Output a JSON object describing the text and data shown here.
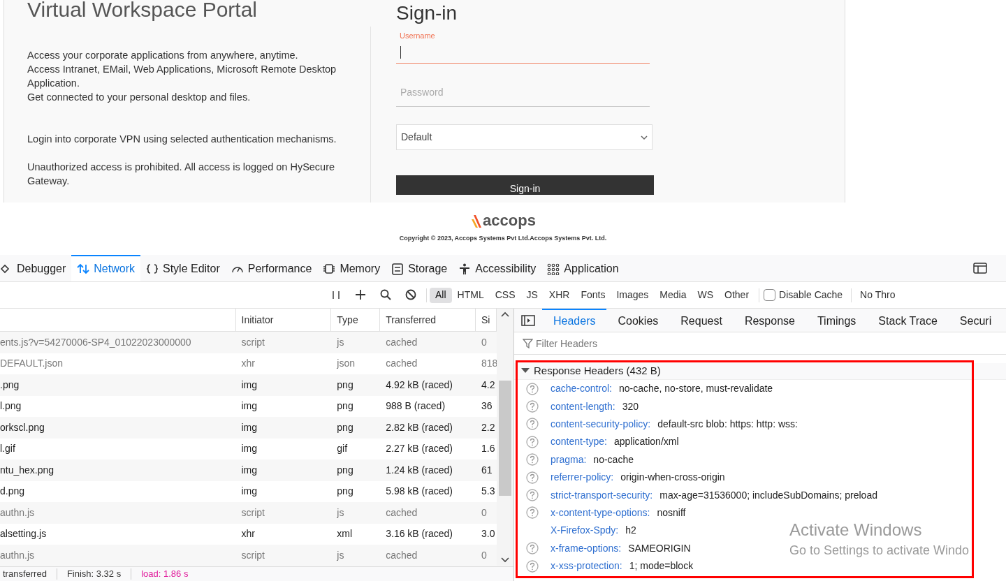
{
  "portal": {
    "title": "Virtual Workspace Portal",
    "paragraphs": [
      "Access your corporate applications from anywhere, anytime.\nAccess Intranet, EMail, Web Applications, Microsoft Remote Desktop Application.\nGet connected to your personal desktop and files.",
      "Login into corporate VPN using selected authentication mechanisms.",
      "Unauthorized access is prohibited. All access is logged on HySecure Gateway."
    ]
  },
  "signin": {
    "title": "Sign-in",
    "username": {
      "label": "Username",
      "focused": true
    },
    "password": {
      "placeholder": "Password"
    },
    "realm": {
      "value": "Default"
    },
    "button": "Sign-in"
  },
  "footer": {
    "brand": "accops",
    "copyright": "Copyright © 2023, Accops Systems Pvt Ltd.Accops Systems Pvt. Ltd."
  },
  "devtools": {
    "tabs": [
      {
        "label": "Debugger",
        "selected": false
      },
      {
        "label": "Network",
        "selected": true
      },
      {
        "label": "Style Editor",
        "selected": false
      },
      {
        "label": "Performance",
        "selected": false
      },
      {
        "label": "Memory",
        "selected": false
      },
      {
        "label": "Storage",
        "selected": false
      },
      {
        "label": "Accessibility",
        "selected": false
      },
      {
        "label": "Application",
        "selected": false
      }
    ],
    "filters": [
      {
        "label": "All",
        "selected": true
      },
      {
        "label": "HTML",
        "selected": false
      },
      {
        "label": "CSS",
        "selected": false
      },
      {
        "label": "JS",
        "selected": false
      },
      {
        "label": "XHR",
        "selected": false
      },
      {
        "label": "Fonts",
        "selected": false
      },
      {
        "label": "Images",
        "selected": false
      },
      {
        "label": "Media",
        "selected": false
      },
      {
        "label": "WS",
        "selected": false
      },
      {
        "label": "Other",
        "selected": false
      }
    ],
    "disable_cache": {
      "label": "Disable Cache",
      "checked": false
    },
    "throttling": "No Thro"
  },
  "requests": {
    "columns": [
      "Initiator",
      "Type",
      "Transferred",
      "Si"
    ],
    "rows": [
      {
        "file": "ents.js?v=54270006-SP4_01022023000000",
        "initiator": "script",
        "type": "js",
        "transferred": "cached",
        "size": "0",
        "cached": true
      },
      {
        "file": "DEFAULT.json",
        "initiator": "xhr",
        "type": "json",
        "transferred": "cached",
        "size": "818",
        "cached": true
      },
      {
        "file": ".png",
        "initiator": "img",
        "type": "png",
        "transferred": "4.92 kB (raced)",
        "size": "4.2",
        "cached": false
      },
      {
        "file": "l.png",
        "initiator": "img",
        "type": "png",
        "transferred": "988 B (raced)",
        "size": "36",
        "cached": false
      },
      {
        "file": "orkscl.png",
        "initiator": "img",
        "type": "png",
        "transferred": "2.82 kB (raced)",
        "size": "2.2",
        "cached": false
      },
      {
        "file": "l.gif",
        "initiator": "img",
        "type": "gif",
        "transferred": "2.27 kB (raced)",
        "size": "1.6",
        "cached": false
      },
      {
        "file": "ntu_hex.png",
        "initiator": "img",
        "type": "png",
        "transferred": "1.24 kB (raced)",
        "size": "61",
        "cached": false
      },
      {
        "file": "d.png",
        "initiator": "img",
        "type": "png",
        "transferred": "5.98 kB (raced)",
        "size": "5.3",
        "cached": false
      },
      {
        "file": "authn.js",
        "initiator": "script",
        "type": "js",
        "transferred": "cached",
        "size": "0",
        "cached": true
      },
      {
        "file": "alsetting.js",
        "initiator": "xhr",
        "type": "xml",
        "transferred": "3.16 kB (raced)",
        "size": "3.0",
        "cached": false
      },
      {
        "file": "authn.js",
        "initiator": "script",
        "type": "js",
        "transferred": "cached",
        "size": "0",
        "cached": true
      }
    ]
  },
  "status_bar": [
    {
      "text": "transferred",
      "color": "#333333"
    },
    {
      "text": "Finish: 3.32 s",
      "color": "#333333"
    },
    {
      "text": "load: 1.86 s",
      "color": "#e01a9b"
    }
  ],
  "details": {
    "tabs": [
      {
        "label": "Headers",
        "selected": true
      },
      {
        "label": "Cookies",
        "selected": false
      },
      {
        "label": "Request",
        "selected": false
      },
      {
        "label": "Response",
        "selected": false
      },
      {
        "label": "Timings",
        "selected": false
      },
      {
        "label": "Stack Trace",
        "selected": false
      },
      {
        "label": "Securi",
        "selected": false
      }
    ],
    "filter_placeholder": "Filter Headers",
    "section": {
      "title": "Response Headers (432 B)",
      "expanded": true
    },
    "headers": [
      {
        "name": "cache-control:",
        "value": "no-cache, no-store, must-revalidate",
        "help": true
      },
      {
        "name": "content-length:",
        "value": "320",
        "help": true
      },
      {
        "name": "content-security-policy:",
        "value": "default-src blob: https: http: wss:",
        "help": true
      },
      {
        "name": "content-type:",
        "value": "application/xml",
        "help": true
      },
      {
        "name": "pragma:",
        "value": "no-cache",
        "help": true
      },
      {
        "name": "referrer-policy:",
        "value": "origin-when-cross-origin",
        "help": true
      },
      {
        "name": "strict-transport-security:",
        "value": "max-age=31536000; includeSubDomains; preload",
        "help": true
      },
      {
        "name": "x-content-type-options:",
        "value": "nosniff",
        "help": true
      },
      {
        "name": "X-Firefox-Spdy:",
        "value": "h2",
        "help": false
      },
      {
        "name": "x-frame-options:",
        "value": "SAMEORIGIN",
        "help": true
      },
      {
        "name": "x-xss-protection:",
        "value": "1; mode=block",
        "help": true
      }
    ]
  },
  "os_notice": {
    "title": "Activate Windows",
    "subtitle": "Go to Settings to activate Windo"
  }
}
